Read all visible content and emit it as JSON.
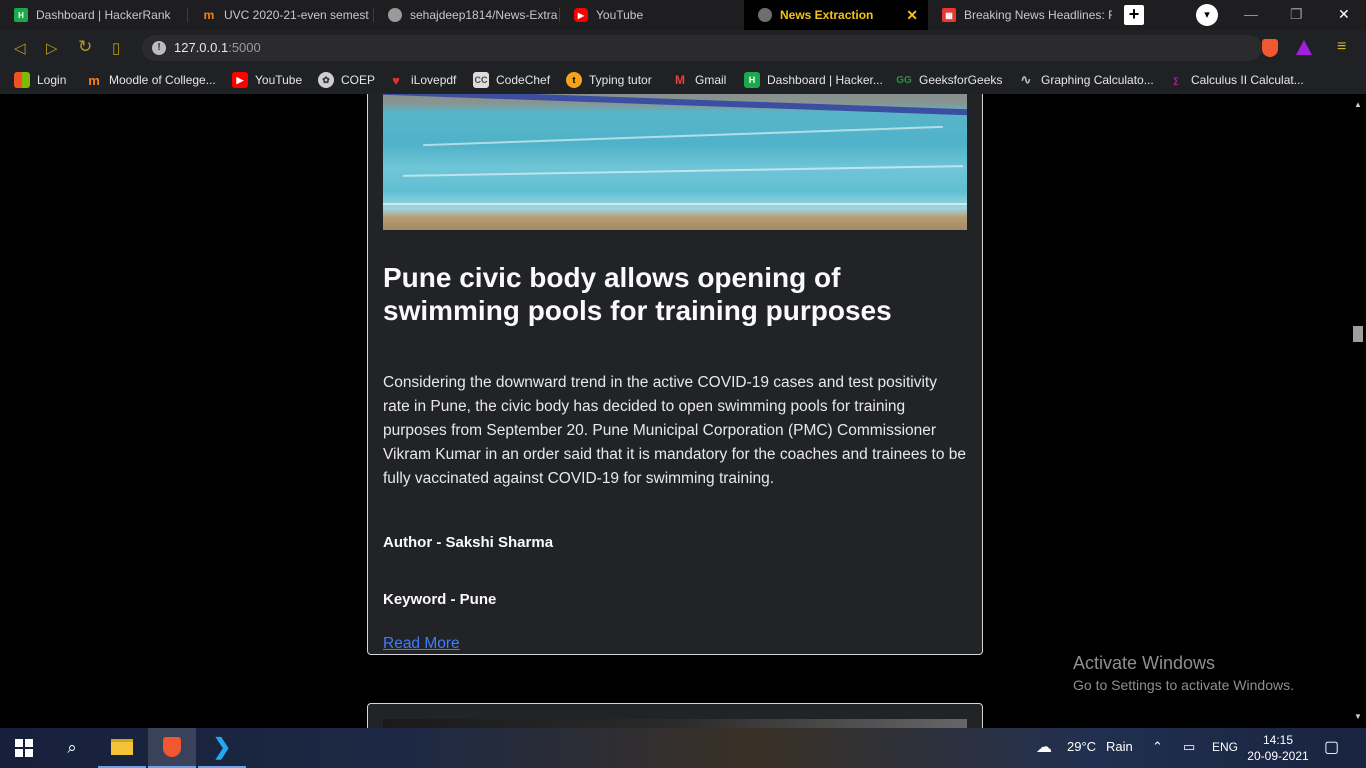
{
  "browser": {
    "tabs": [
      {
        "title": "Dashboard | HackerRank",
        "icon": "hackerrank-icon",
        "color": "#1ba94c"
      },
      {
        "title": "UVC 2020-21-even semest",
        "icon": "moodle-icon",
        "color": "#f98012"
      },
      {
        "title": "sehajdeep1814/News-Extra",
        "icon": "github-icon",
        "color": "#9a9a9a"
      },
      {
        "title": "YouTube",
        "icon": "youtube-icon",
        "color": "#ff0000"
      },
      {
        "title": "News Extraction",
        "icon": "globe-icon",
        "color": "#8a8a8a",
        "active": true
      },
      {
        "title": "Breaking News Headlines: R",
        "icon": "news-icon",
        "color": "#e53935"
      }
    ],
    "new_tab_label": "+",
    "close_tab_label": "✕",
    "url": {
      "host": "127.0.0.1",
      "port": ":5000"
    },
    "bookmarks": [
      {
        "label": "Login",
        "icon": "microsoft-icon"
      },
      {
        "label": "Moodle of College...",
        "icon": "moodle-icon"
      },
      {
        "label": "YouTube",
        "icon": "youtube-icon"
      },
      {
        "label": "COEP",
        "icon": "coep-icon"
      },
      {
        "label": "iLovepdf",
        "icon": "ilovepdf-icon"
      },
      {
        "label": "CodeChef",
        "icon": "codechef-icon"
      },
      {
        "label": "Typing tutor",
        "icon": "typing-tutor-icon"
      },
      {
        "label": "Gmail",
        "icon": "gmail-icon"
      },
      {
        "label": "Dashboard | Hacker...",
        "icon": "hackerrank-icon"
      },
      {
        "label": "GeeksforGeeks",
        "icon": "geeksforgeeks-icon"
      },
      {
        "label": "Graphing Calculato...",
        "icon": "desmos-icon"
      },
      {
        "label": "Calculus II Calculat...",
        "icon": "symbolab-icon"
      }
    ]
  },
  "article": {
    "title": "Pune civic body allows opening of swimming pools for training purposes",
    "description": "Considering the downward trend in the active COVID-19 cases and test positivity rate in Pune, the civic body has decided to open swimming pools for training purposes from September 20. Pune Municipal Corporation (PMC) Commissioner Vikram Kumar in an order said that it is mandatory for the coaches and trainees to be fully vaccinated against COVID-19 for swimming training.",
    "author": "Author - Sakshi Sharma",
    "keyword": "Keyword - Pune",
    "link_label": "Read More"
  },
  "watermark": {
    "title": "Activate Windows",
    "subtitle": "Go to Settings to activate Windows."
  },
  "taskbar": {
    "weather": "29°C",
    "weather_desc": "Rain",
    "language": "ENG",
    "time": "14:15",
    "date": "20-09-2021"
  },
  "colors": {
    "accent_tab": "#f3c313",
    "link": "#3d7eff",
    "card_bg": "#212327"
  }
}
